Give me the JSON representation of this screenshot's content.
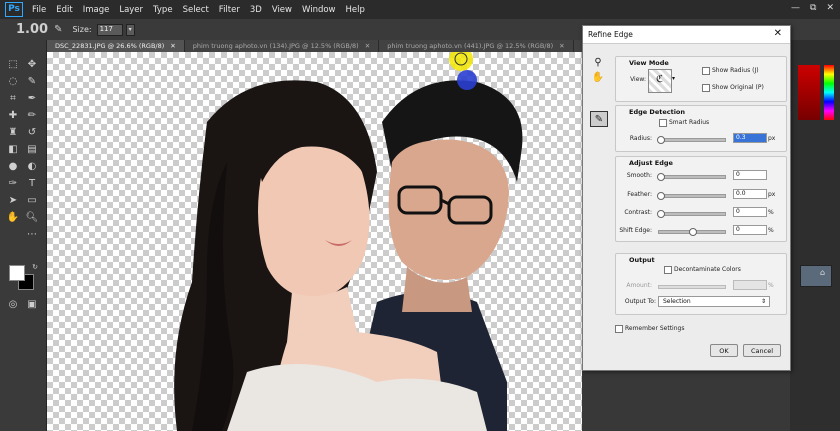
{
  "menubar": {
    "logo": "Ps",
    "items": [
      "File",
      "Edit",
      "Image",
      "Layer",
      "Type",
      "Select",
      "Filter",
      "3D",
      "View",
      "Window",
      "Help"
    ],
    "controls": [
      "—",
      "⧉",
      "✕"
    ]
  },
  "options": {
    "brush_size_display": "1.00",
    "size_label": "Size:",
    "size_value": "117"
  },
  "tabs": [
    {
      "label": "DSC_22831.JPG @ 26.6% (RGB/8)"
    },
    {
      "label": "phim truong aphoto.vn (134).JPG @ 12.5% (RGB/8)"
    },
    {
      "label": "phim truong aphoto.vn (441).JPG @ 12.5% (RGB/8)"
    }
  ],
  "dialog": {
    "title": "Refine Edge",
    "close": "✕",
    "view_mode": {
      "title": "View Mode",
      "view_label": "View:",
      "show_radius": "Show Radius (J)",
      "show_original": "Show Original (P)"
    },
    "edge_detection": {
      "title": "Edge Detection",
      "smart_radius": "Smart Radius",
      "radius_label": "Radius:",
      "radius_value": "0.3",
      "radius_unit": "px"
    },
    "adjust_edge": {
      "title": "Adjust Edge",
      "smooth_label": "Smooth:",
      "smooth_value": "0",
      "feather_label": "Feather:",
      "feather_value": "0.0",
      "feather_unit": "px",
      "contrast_label": "Contrast:",
      "contrast_value": "0",
      "contrast_unit": "%",
      "shift_label": "Shift Edge:",
      "shift_value": "0",
      "shift_unit": "%"
    },
    "output": {
      "title": "Output",
      "decontaminate": "Decontaminate Colors",
      "amount_label": "Amount:",
      "amount_unit": "%",
      "output_to_label": "Output To:",
      "output_to_value": "Selection"
    },
    "remember": "Remember Settings",
    "ok": "OK",
    "cancel": "Cancel"
  }
}
